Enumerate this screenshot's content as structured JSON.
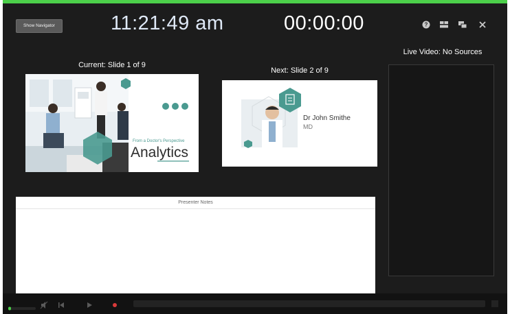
{
  "toolbar": {
    "show_navigator_label": "Show Navigator",
    "clock": "11:21:49 am",
    "timer": "00:00:00",
    "icons": [
      "help-icon",
      "layout-icon",
      "swap-displays-icon",
      "close-icon"
    ]
  },
  "current": {
    "label": "Current: Slide 1 of 9",
    "slide": {
      "subtitle": "From a Doctor's Perspective",
      "title": "Analytics"
    }
  },
  "next": {
    "label": "Next: Slide 2 of 9",
    "slide": {
      "name": "Dr John Smithe",
      "role": "MD"
    }
  },
  "live_video": {
    "label": "Live Video: No Sources"
  },
  "notes": {
    "header": "Presenter Notes",
    "text": ""
  },
  "colors": {
    "accent": "#4cd04a",
    "teal": "#4a9a90",
    "background": "#1c1c1c",
    "record": "#d93a3a"
  },
  "bottom_bar": {
    "icons": [
      "volume-icon",
      "mute-icon",
      "previous-icon",
      "play-icon",
      "record-icon"
    ]
  }
}
